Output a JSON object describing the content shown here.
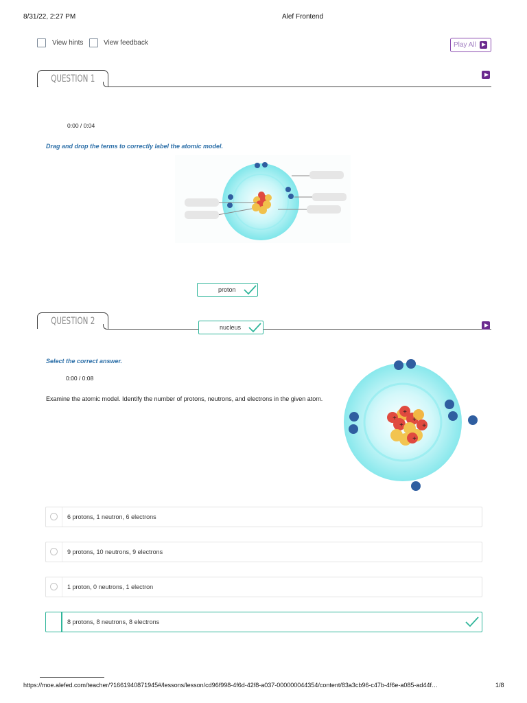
{
  "print": {
    "date": "8/31/22, 2:27 PM",
    "title": "Alef Frontend",
    "url": "https://moe.alefed.com/teacher/?1661940871945#/lessons/lesson/cd96f998-4f6d-42f8-a037-000000044354/content/83a3cb96-c47b-4f6e-a085-ad44f…",
    "page": "1/8"
  },
  "toolbar": {
    "view_hints": "View hints",
    "view_feedback": "View feedback",
    "play_all": "Play All"
  },
  "question1": {
    "tab": "QUESTION 1",
    "timestamp": "0:00 / 0:04",
    "instruction": "Drag and drop the terms to correctly label the atomic model.",
    "chips": [
      "proton",
      "nucleus"
    ]
  },
  "question2": {
    "tab": "QUESTION 2",
    "instruction": "Select the correct answer.",
    "timestamp": "0:00 / 0:08",
    "prompt": "Examine the atomic model. Identify the number of protons, neutrons, and electrons in the given atom.",
    "options": [
      {
        "label": "6 protons, 1 neutron, 6 electrons",
        "correct": false
      },
      {
        "label": "9 protons, 10 neutrons, 9 electrons",
        "correct": false
      },
      {
        "label": "1 proton, 0 neutrons, 1 electron",
        "correct": false
      },
      {
        "label": "8 protons, 8 neutrons, 8 electrons",
        "correct": true
      }
    ]
  },
  "colors": {
    "accent_purple": "#6b2a8e",
    "correct_green": "#2fb59a",
    "instruction_blue": "#2c6fa8",
    "orbit_cyan": "#7fe6ea",
    "electron_blue": "#2f5ea0"
  },
  "icons": [
    "play-icon",
    "checkmark-icon",
    "radio-icon",
    "checkbox-icon"
  ]
}
